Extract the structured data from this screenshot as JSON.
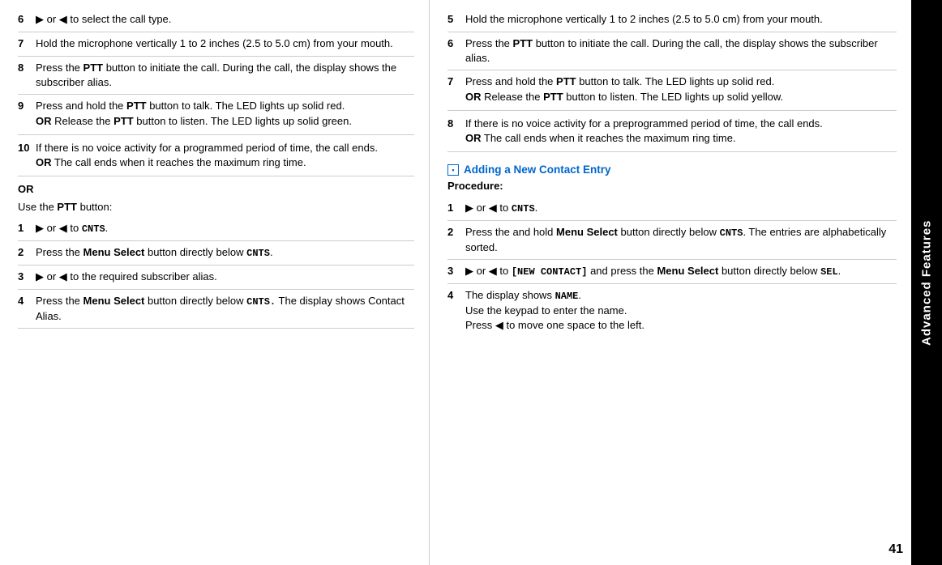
{
  "sidebar": {
    "label": "Advanced Features"
  },
  "page_number": "41",
  "left_column": {
    "step6": {
      "num": "6",
      "text_before": "",
      "content": "▶ or ◀ to select the call type."
    },
    "step7": {
      "num": "7",
      "content": "Hold the microphone vertically 1 to 2 inches (2.5 to 5.0 cm) from your mouth."
    },
    "step8": {
      "num": "8",
      "content_start": "Press the ",
      "bold1": "PTT",
      "content_mid": " button to initiate the call. During the call, the display shows the subscriber alias."
    },
    "step9": {
      "num": "9",
      "content_start": "Press and hold the ",
      "bold1": "PTT",
      "content_mid": " button to talk. The LED lights up solid red.",
      "or": "OR",
      "content_end_start": "Release the ",
      "bold2": "PTT",
      "content_end": " button to listen. The LED lights up solid green."
    },
    "step10": {
      "num": "10",
      "content": "If there is no voice activity for a programmed period of time, the call ends.",
      "or": "OR",
      "content_end": "The call ends when it reaches the maximum ring time."
    },
    "or_section": {
      "or": "OR",
      "use_ptt": "Use the ",
      "ptt_bold": "PTT",
      "use_ptt_end": " button:"
    },
    "sub_step1": {
      "num": "1",
      "content": "▶ or ◀ to ",
      "mono": "CNTS",
      "end": "."
    },
    "sub_step2": {
      "num": "2",
      "content_start": "Press the ",
      "bold1": "Menu Select",
      "content_mid": " button directly below ",
      "mono": "CNTS",
      "end": "."
    },
    "sub_step3": {
      "num": "3",
      "content": "▶ or ◀ to the required subscriber alias."
    },
    "sub_step4": {
      "num": "4",
      "content_start": "Press the ",
      "bold1": "Menu Select",
      "content_mid": " button directly below ",
      "mono": "CNTS.",
      "content_end": " The display shows Contact Alias."
    }
  },
  "right_column": {
    "step5": {
      "num": "5",
      "content": "Hold the microphone vertically 1 to 2 inches (2.5 to 5.0 cm) from your mouth."
    },
    "step6": {
      "num": "6",
      "content_start": "Press the ",
      "bold1": "PTT",
      "content_mid": " button to initiate the call. During the call, the display shows the subscriber alias."
    },
    "step7": {
      "num": "7",
      "content_start": "Press and hold the ",
      "bold1": "PTT",
      "content_mid": " button to talk. The LED lights up solid red.",
      "or": "OR",
      "content_end_start": "Release the ",
      "bold2": "PTT",
      "content_end": " button to listen. The LED lights up solid yellow."
    },
    "step8": {
      "num": "8",
      "content": "If there is no voice activity for a preprogrammed period of time, the call ends.",
      "or": "OR",
      "content_end": "The call ends when it reaches the maximum ring time."
    },
    "section": {
      "heading": "Adding a New Contact Entry",
      "procedure_label": "Procedure:",
      "step1": {
        "num": "1",
        "content": "▶ or ◀ to ",
        "mono": "CNTS",
        "end": "."
      },
      "step2": {
        "num": "2",
        "content_start": "Press the and hold ",
        "bold1": "Menu Select",
        "content_mid": " button directly below ",
        "mono": "CNTS",
        "content_end": ". The entries are alphabetically sorted."
      },
      "step3": {
        "num": "3",
        "content_start": "▶ or ◀ to ",
        "mono1": "[NEW CONTACT]",
        "content_mid": " and press the ",
        "bold1": "Menu Select",
        "content_end": " button directly below ",
        "mono2": "SEL",
        "end": "."
      },
      "step4": {
        "num": "4",
        "content_start": "The display shows ",
        "mono1": "NAME",
        "content_mid": ".",
        "line2": "Use the keypad to enter the name.",
        "line3": "Press ◀ to move one space to the left."
      }
    }
  }
}
